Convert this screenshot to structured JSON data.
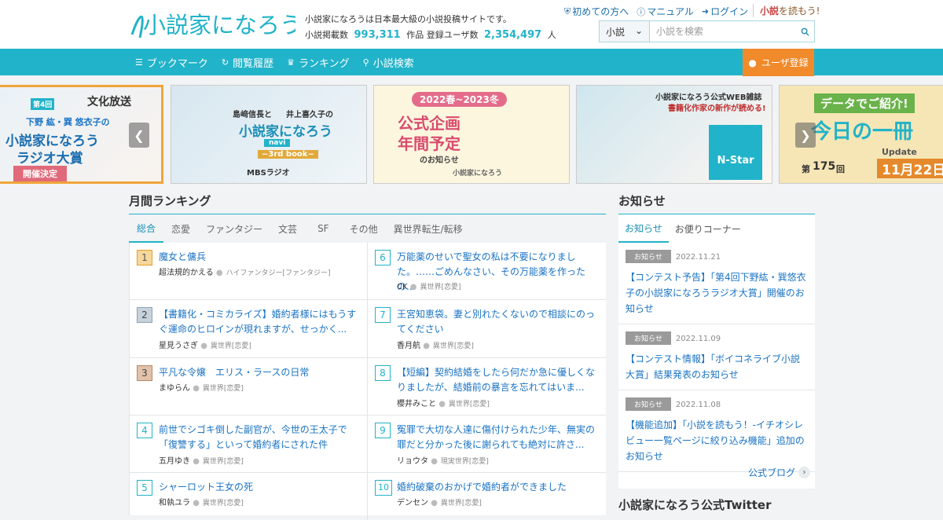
{
  "header": {
    "logo_text": "小説家になろう",
    "tagline": "小説家になろうは日本最大級の小説投稿サイトです。",
    "stats": {
      "works_label": "小説掲載数",
      "works_count": "993,311",
      "works_unit": "作品",
      "users_label": "登録ユーザ数",
      "users_count": "2,354,497",
      "users_unit": "人"
    },
    "links": {
      "beginner": "初めての方へ",
      "manual": "マニュアル",
      "login": "ログイン"
    },
    "yomou": {
      "prefix": "小説",
      "suffix": "を読もう!"
    },
    "search": {
      "select_value": "小説",
      "placeholder": "小説を検索"
    }
  },
  "nav": {
    "items": [
      {
        "label": "ブックマーク",
        "icon": "bookmark-icon"
      },
      {
        "label": "閲覧履歴",
        "icon": "history-icon"
      },
      {
        "label": "ランキング",
        "icon": "crown-icon"
      },
      {
        "label": "小説検索",
        "icon": "search-icon"
      }
    ],
    "register": "ユーザ登録"
  },
  "banners": [
    {
      "lines": [
        "第4回",
        "文化放送",
        "下野 紘・巽 悠衣子の",
        "小説家になろう",
        "ラジオ大賞",
        "開催決定"
      ]
    },
    {
      "lines": [
        "島﨑信長と",
        "井上喜久子の",
        "小説家になろう",
        "navi",
        "~3rd book~",
        "MBSラジオ"
      ]
    },
    {
      "lines": [
        "2022春~2023冬",
        "公式企画",
        "年間予定",
        "のお知らせ",
        "小説家になろう"
      ]
    },
    {
      "lines": [
        "小説家になろう公式WEB雑誌",
        "書籍化作家の新作が読める!",
        "N-Star"
      ]
    },
    {
      "lines": [
        "データでご紹介!",
        "今日の一冊",
        "Update",
        "第",
        "175",
        "回",
        "11月22日"
      ]
    }
  ],
  "ranking": {
    "title": "月間ランキング",
    "tabs": [
      "総合",
      "恋愛",
      "ファンタジー",
      "文芸",
      "SF",
      "その他",
      "異世界転生/転移"
    ],
    "items": [
      {
        "rank": "1",
        "title": "魔女と傭兵",
        "author": "超法規的かえる",
        "genre": "ハイファンタジー[ファンタジー]"
      },
      {
        "rank": "2",
        "title": "【書籍化・コミカライズ】婚約者様にはもうすぐ運命のヒロインが現れますが、せっかく...",
        "author": "星見うさぎ",
        "genre": "異世界[恋愛]"
      },
      {
        "rank": "3",
        "title": "平凡な令嬢　エリス・ラースの日常",
        "author": "まゆらん",
        "genre": "異世界[恋愛]"
      },
      {
        "rank": "4",
        "title": "前世でシゴキ倒した副官が、今世の王太子で「復讐する」といって婚約者にされた件",
        "author": "五月ゆき",
        "genre": "異世界[恋愛]"
      },
      {
        "rank": "5",
        "title": "シャーロット王女の死",
        "author": "和執ユラ",
        "genre": "異世界[恋愛]"
      },
      {
        "rank": "6",
        "title": "万能薬のせいで聖女の私は不要になりました。……ごめんなさい、その万能薬を作ったの...",
        "author": "CK",
        "genre": "異世界[恋愛]"
      },
      {
        "rank": "7",
        "title": "王宮知恵袋。妻と別れたくないので相談にのってください",
        "author": "香月航",
        "genre": "異世界[恋愛]"
      },
      {
        "rank": "8",
        "title": "【短編】契約結婚をしたら何だか急に優しくなりましたが、結婚前の暴言を忘れてはいま...",
        "author": "櫻井みこと",
        "genre": "異世界[恋愛]"
      },
      {
        "rank": "9",
        "title": "冤罪で大切な人達に傷付けられた少年、無実の罪だと分かった後に謝られても絶対に許さ...",
        "author": "リョウタ",
        "genre": "現実世界[恋愛]"
      },
      {
        "rank": "10",
        "title": "婚約破棄のおかげで婚約者ができました",
        "author": "デンセン",
        "genre": "異世界[恋愛]"
      }
    ]
  },
  "news": {
    "title": "お知らせ",
    "tabs": [
      "お知らせ",
      "お便りコーナー"
    ],
    "items": [
      {
        "badge": "お知らせ",
        "date": "2022.11.21",
        "text": "【コンテスト予告】「第4回下野紘・巽悠衣子の小説家になろうラジオ大賞」開催のお知らせ"
      },
      {
        "badge": "お知らせ",
        "date": "2022.11.09",
        "text": "【コンテスト情報】「ボイコネライブ小説大賞」結果発表のお知らせ"
      },
      {
        "badge": "お知らせ",
        "date": "2022.11.08",
        "text": "【機能追加】「小説を読もう！-イチオシレビュー一覧ページに絞り込み機能」追加のお知らせ"
      }
    ],
    "blog_link": "公式ブログ"
  },
  "twitter_title": "小説家になろう公式Twitter",
  "colors": {
    "accent": "#21b3c9",
    "register": "#f08a2a",
    "link": "#1a73c4"
  }
}
